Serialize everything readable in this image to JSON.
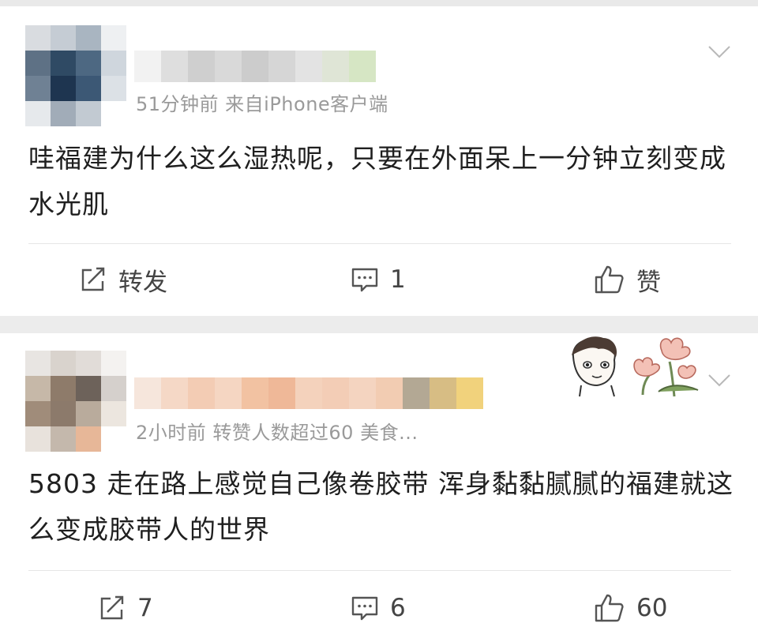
{
  "colors": {
    "accent": "#9a9a9a",
    "divider": "#e6e6e6",
    "page_gap": "#ececec"
  },
  "posts": [
    {
      "meta": "51分钟前  来自iPhone客户端",
      "content": "哇福建为什么这么湿热呢，只要在外面呆上一分钟立刻变成水光肌",
      "actions": {
        "repost": "转发",
        "comment": "1",
        "like": "赞"
      },
      "icons": {
        "repost": "share-icon",
        "comment": "comment-icon",
        "like": "thumbs-up-icon",
        "menu": "chevron-down-icon"
      }
    },
    {
      "meta": "2小时前  转赞人数超过60  美食...",
      "content": "5803 走在路上感觉自己像卷胶带 浑身黏黏腻腻的福建就这么变成胶带人的世界",
      "actions": {
        "repost": "7",
        "comment": "6",
        "like": "60"
      },
      "icons": {
        "repost": "share-icon",
        "comment": "comment-icon",
        "like": "thumbs-up-icon",
        "menu": "chevron-down-icon"
      }
    }
  ]
}
